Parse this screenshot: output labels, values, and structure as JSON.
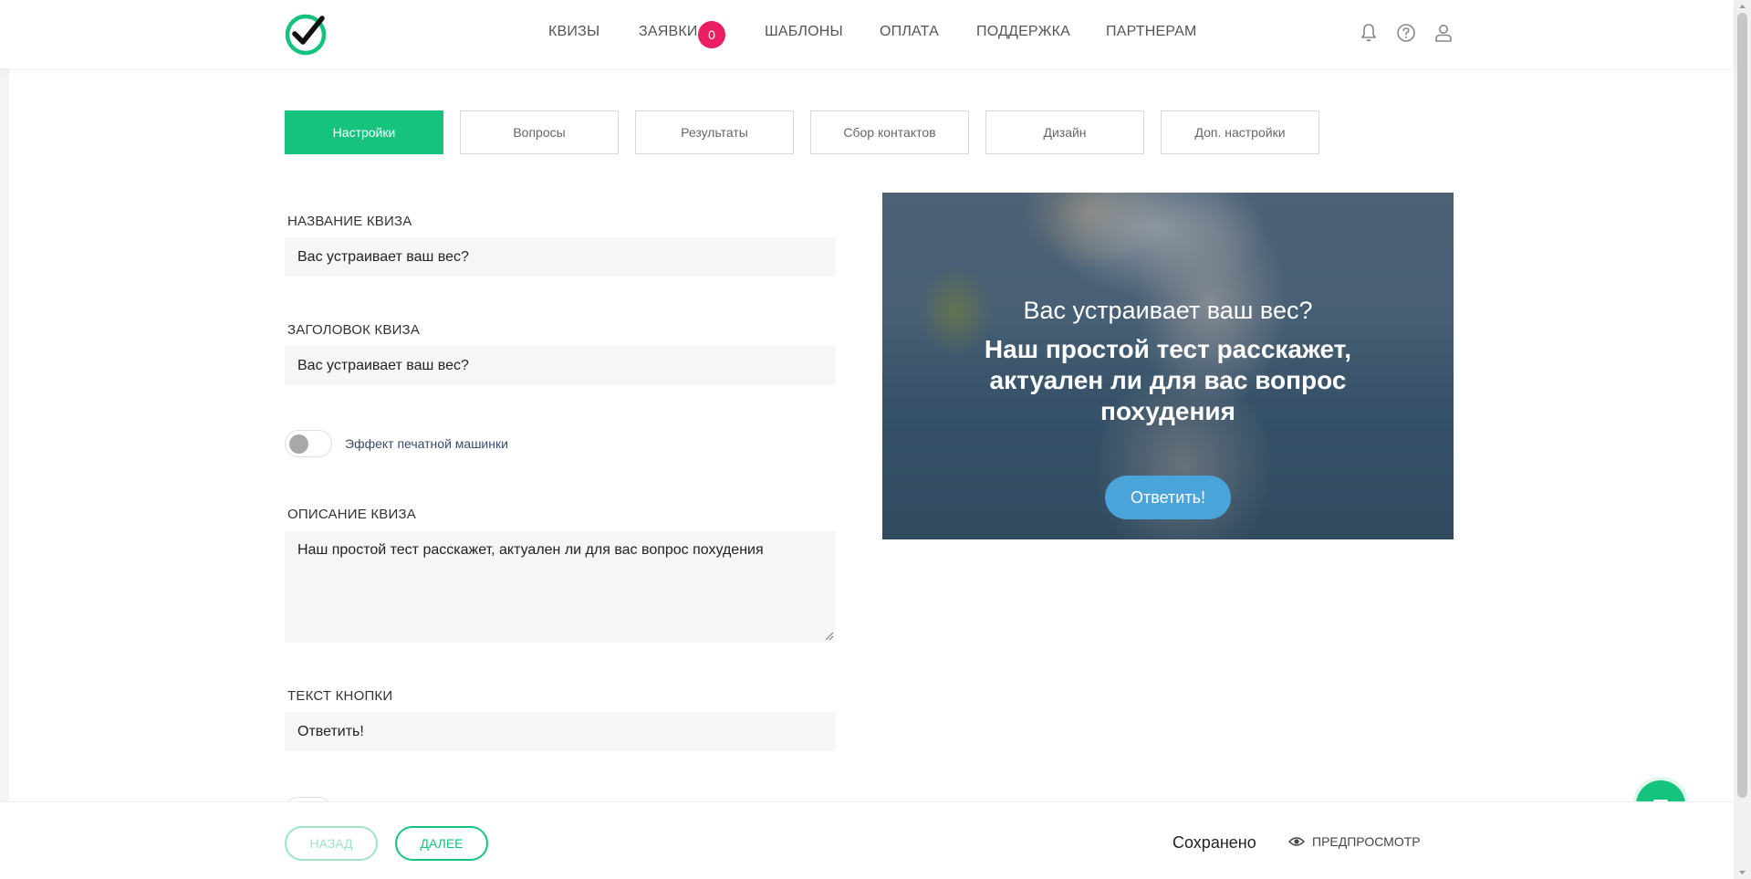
{
  "nav": {
    "items": [
      "КВИЗЫ",
      "ЗАЯВКИ",
      "ШАБЛОНЫ",
      "ОПЛАТА",
      "ПОДДЕРЖКА",
      "ПАРТНЕРАМ"
    ],
    "badge": "0"
  },
  "tabs": [
    "Настройки",
    "Вопросы",
    "Результаты",
    "Сбор контактов",
    "Дизайн",
    "Доп. настройки"
  ],
  "form": {
    "name_label": "НАЗВАНИЕ КВИЗА",
    "name_value": "Вас устраивает ваш вес?",
    "title_label": "ЗАГОЛОВОК КВИЗА",
    "title_value": "Вас устраивает ваш вес?",
    "typewriter_label": "Эффект печатной машинки",
    "description_label": "ОПИСАНИЕ КВИЗА",
    "description_value": "Наш простой тест расскажет, актуален ли для вас вопрос похудения",
    "button_label": "ТЕКСТ КНОПКИ",
    "button_value": "Ответить!"
  },
  "preview": {
    "title": "Вас устраивает ваш вес?",
    "description": "Наш простой тест расскажет, актуален ли для вас вопрос похудения",
    "button": "Ответить!"
  },
  "footer": {
    "back": "НАЗАД",
    "next": "ДАЛЕЕ",
    "saved": "Сохранено",
    "preview": "ПРЕДПРОСМОТР"
  },
  "colors": {
    "accent": "#15c27e",
    "badge": "#e91e63",
    "preview_button": "#4aa3d9"
  }
}
